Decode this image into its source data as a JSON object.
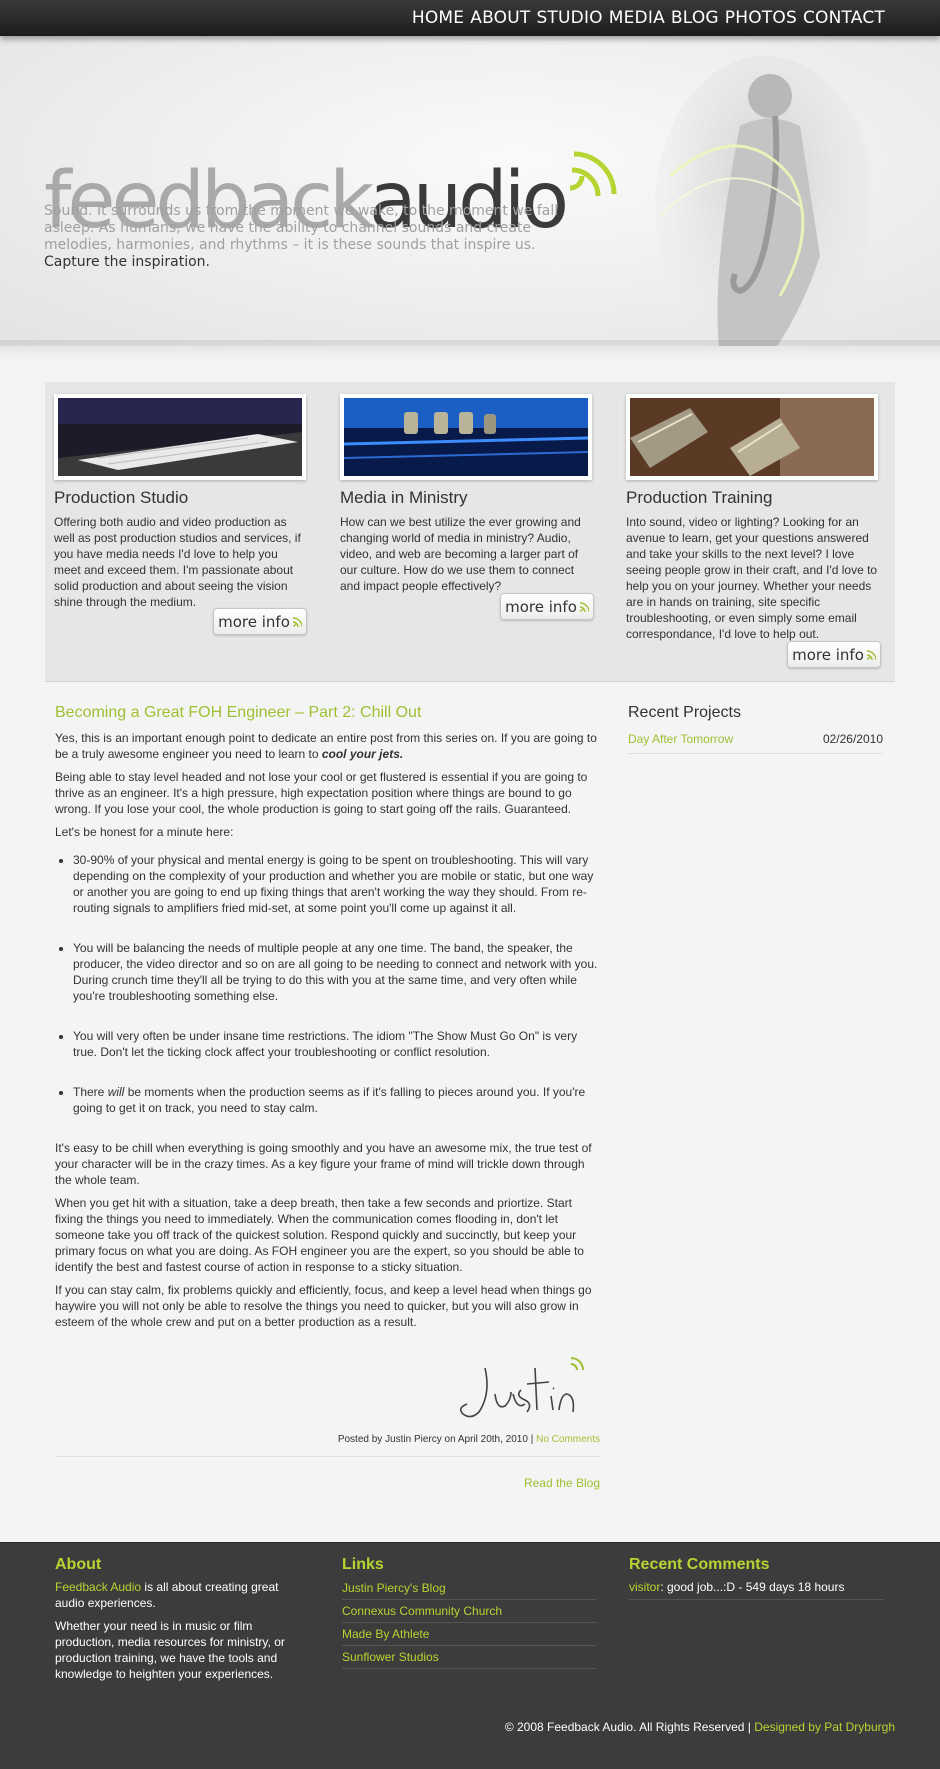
{
  "nav": {
    "items": [
      "HOME",
      "ABOUT",
      "STUDIO",
      "MEDIA",
      "BLOG",
      "PHOTOS",
      "CONTACT"
    ]
  },
  "hero": {
    "logo_part1": "feedback",
    "logo_part2": "audio",
    "tagline": "Sound. It surrounds us from the moment we wake, to the moment we fall asleep. As humans, we have the ability to channel sounds and create melodies, harmonies, and rhythms – it is these sounds that inspire us.",
    "tagline2": "Capture the inspiration."
  },
  "features": [
    {
      "title": "Production Studio",
      "text": "Offering both audio and video production as well as post production studios and services, if you have media needs I'd love to help you meet and exceed them. I'm passionate about solid production and about seeing the vision shine through the medium.",
      "button": "more info"
    },
    {
      "title": "Media in Ministry",
      "text": "How can we best utilize the ever growing and changing world of media in ministry? Audio, video, and web are becoming a larger part of our culture. How do we use them to connect and impact people effectively?",
      "button": "more info"
    },
    {
      "title": "Production Training",
      "text": "Into sound, video or lighting? Looking for an avenue to learn, get your questions answered and take your skills to the next level? I love seeing people grow in their craft, and I'd love to help you on your journey. Whether your needs are in hands on training, site specific troubleshooting, or even simply some email correspondance, I'd love to help out.",
      "button": "more info"
    }
  ],
  "post": {
    "title": "Becoming a Great FOH Engineer – Part 2: Chill Out",
    "p1_lead": "Yes, this is an important enough point to dedicate an entire post from this series on. If you are going to be a truly awesome engineer you need to learn to ",
    "p1_emph": "cool your jets.",
    "p2": "Being able  to stay level headed and not lose your cool or get flustered is essential if you are going to thrive as an engineer. It's a high pressure, high expectation position where things are bound to go wrong. If you lose your cool, the whole production is going to start going off the rails. Guaranteed.",
    "p3": "Let's be honest for a minute here:",
    "bullet1": "30-90% of your physical and mental energy is going to be spent on troubleshooting. This will vary depending on the complexity of your production and whether you are mobile or static, but one way or another you are going to end up fixing things that aren't working the way they should. From re-routing signals to amplifiers fried mid-set, at some point you'll come up against it all.",
    "bullet2": "You will be balancing the needs of multiple people at any one time. The band, the speaker, the producer, the video director and so on are all going to be needing to connect and network with you. During crunch time they'll all be trying to do this with you at the same time, and very often while you're troubleshooting something else.",
    "bullet3": "You will very often be under insane time restrictions. The idiom \"The Show Must Go On\" is very true. Don't let the ticking clock affect your troubleshooting or conflict resolution.",
    "bullet4_a": "There ",
    "bullet4_em": "will",
    "bullet4_b": " be moments when the production seems as if it's falling to pieces around you. If you're going to get it on track, you need to stay calm.",
    "p4": "It's easy to be chill when everything is going smoothly and you have an awesome mix, the true test of your character will be in the crazy times. As a key figure your frame of mind will trickle down through the whole team.",
    "p5": "When you get hit with a situation, take a deep breath, then take a few seconds and priortize. Start fixing the things you need to immediately. When the communication comes flooding in, don't let someone take you off track of the quickest solution. Respond quickly and succinctly, but keep your primary focus on what you are doing. As FOH engineer you are the expert, so you should be able to identify the best and fastest course of action in response to a sticky situation.",
    "p6": "If you can stay calm, fix problems quickly and efficiently, focus, and keep a level head when things go haywire  you will not only be able to resolve the things you need to quicker, but you will also grow in esteem of the whole crew and put on a better production as a result.",
    "signature": "Justin",
    "posted_by": "Posted by Justin Piercy on April 20th, 2010 | ",
    "comments_link": "No Comments",
    "read_blog": "Read the Blog"
  },
  "sidebar": {
    "title": "Recent Projects",
    "projects": [
      {
        "name": "Day After Tomorrow",
        "date": "02/26/2010"
      }
    ]
  },
  "footer": {
    "about_title": "About",
    "about_brand": "Feedback Audio",
    "about_p1_rest": " is all about creating great audio experiences.",
    "about_p2": "Whether your need is in music or film production, media resources for ministry, or production training, we have the tools and knowledge to heighten your experiences.",
    "links_title": "Links",
    "links": [
      "Justin Piercy's Blog",
      "Connexus Community Church",
      "Made By Athlete",
      "Sunflower Studios"
    ],
    "comments_title": "Recent Comments",
    "comment_user": "visitor",
    "comment_text": ": good job...:D - 549 days 18 hours",
    "copyright": "© 2008 Feedback Audio. All Rights Reserved | ",
    "designer": "Designed by Pat Dryburgh"
  },
  "colors": {
    "accent_green": "#9ec134",
    "footer_green": "#b6d432",
    "footer_bg": "#3c3c3c",
    "topbar_bg": "#222222"
  }
}
